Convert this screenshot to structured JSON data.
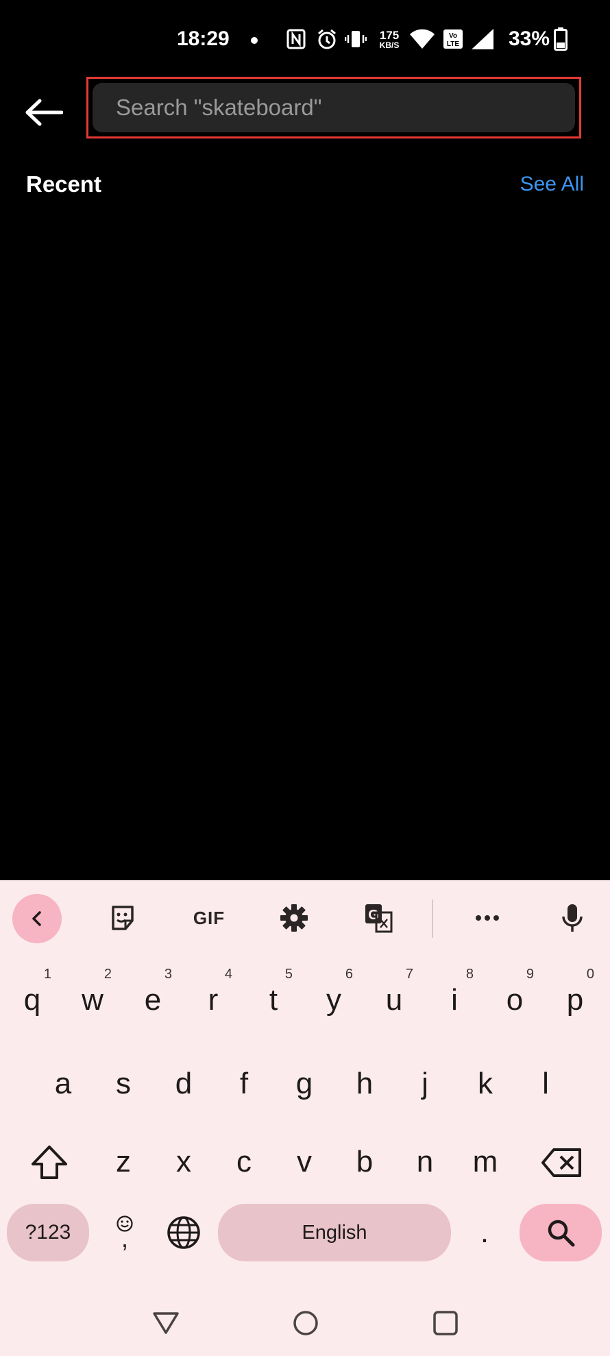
{
  "status_bar": {
    "time": "18:29",
    "data_speed_top": "175",
    "data_speed_bottom": "KB/S",
    "battery": "33%",
    "icons": [
      "notification-dot-icon",
      "nfc-icon",
      "alarm-icon",
      "vibrate-icon",
      "data-speed-icon",
      "wifi-icon",
      "volte-icon",
      "signal-icon",
      "battery-icon"
    ]
  },
  "header": {
    "back_icon": "arrow-left-icon",
    "search_placeholder": "Search \"skateboard\"",
    "search_value": ""
  },
  "recent": {
    "title": "Recent",
    "see_all": "See All"
  },
  "keyboard": {
    "toolbar": [
      "chevron-left-icon",
      "sticker-icon",
      "gif",
      "settings-gear-icon",
      "translate-icon",
      "more-dots-icon",
      "microphone-icon"
    ],
    "gif_label": "GIF",
    "row1": [
      {
        "k": "q",
        "h": "1"
      },
      {
        "k": "w",
        "h": "2"
      },
      {
        "k": "e",
        "h": "3"
      },
      {
        "k": "r",
        "h": "4"
      },
      {
        "k": "t",
        "h": "5"
      },
      {
        "k": "y",
        "h": "6"
      },
      {
        "k": "u",
        "h": "7"
      },
      {
        "k": "i",
        "h": "8"
      },
      {
        "k": "o",
        "h": "9"
      },
      {
        "k": "p",
        "h": "0"
      }
    ],
    "row2": [
      "a",
      "s",
      "d",
      "f",
      "g",
      "h",
      "j",
      "k",
      "l"
    ],
    "row3": [
      "z",
      "x",
      "c",
      "v",
      "b",
      "n",
      "m"
    ],
    "symbols_label": "?123",
    "comma": ",",
    "space_label": "English",
    "period": ".",
    "accent_color": "#f7b4c2",
    "bg_color": "#fcebec"
  },
  "nav_bar": [
    "back-triangle-icon",
    "home-circle-icon",
    "recents-square-icon"
  ]
}
